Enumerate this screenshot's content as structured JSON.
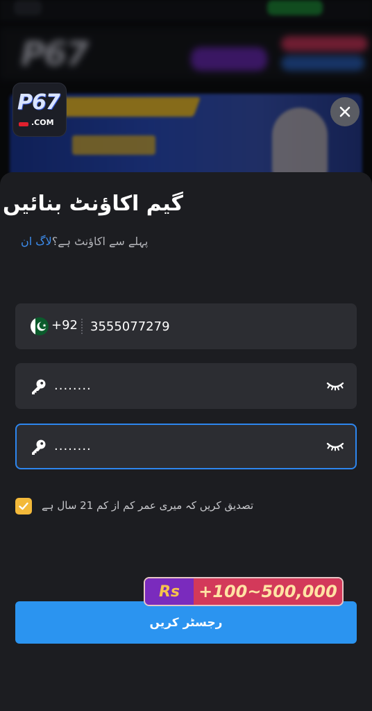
{
  "brand": {
    "logo_text": "P67",
    "logo_domain": ".COM"
  },
  "form": {
    "title": "گیم اکاؤنٹ بنائیں",
    "subtitle_prefix": "پہلے سے اکاؤنٹ ہے؟",
    "login_link": "لاگ ان",
    "phone": {
      "country_code": "+92",
      "value": "3555077279"
    },
    "password": {
      "value": "........"
    },
    "confirm_password": {
      "value": "........"
    },
    "age_checkbox": {
      "checked": true,
      "label": "تصدیق کریں کہ میری عمر کم از کم 21 سال ہے"
    },
    "bonus": {
      "currency": "Rs",
      "amount": "+100~500,000"
    },
    "register_label": "رجسٹر کریں"
  },
  "colors": {
    "accent": "#2b94f0",
    "checkbox": "#f3b93a",
    "sheet_bg": "#1c1d21",
    "field_bg": "#2c2d32",
    "link": "#3d8ef0"
  }
}
